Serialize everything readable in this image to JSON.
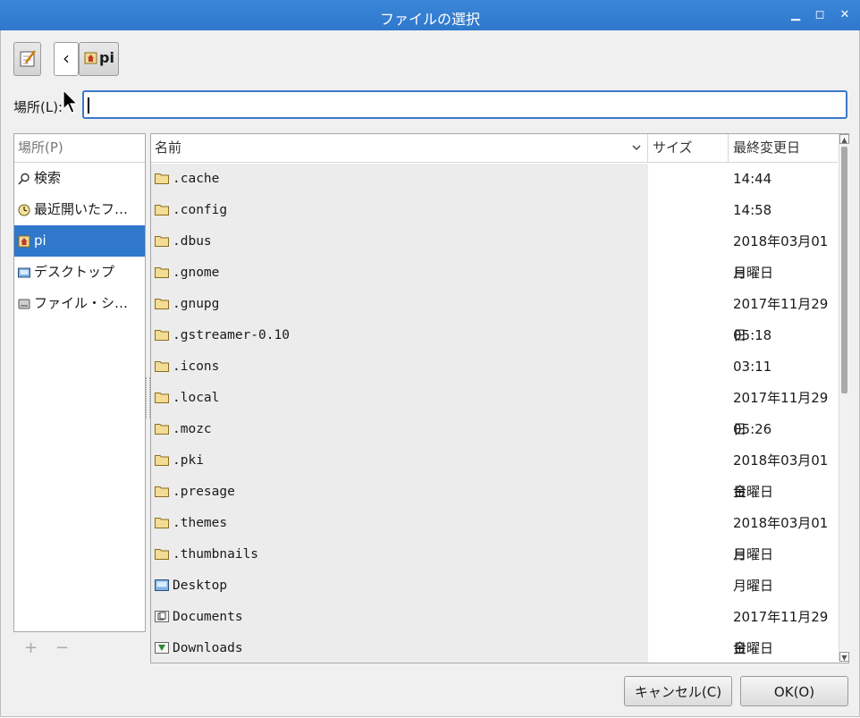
{
  "window": {
    "title": "ファイルの選択",
    "minimize_glyph": "▁",
    "maximize_glyph": "◻",
    "close_glyph": "✕"
  },
  "toolbar": {
    "back_glyph": "‹",
    "path_button_label": "pi",
    "edit_icon": "pencil-icon",
    "home_icon": "home-icon"
  },
  "location": {
    "label": "場所(L):",
    "value": ""
  },
  "places": {
    "header": "場所(P)",
    "items": [
      {
        "label": "検索",
        "icon": "search-icon",
        "selected": false
      },
      {
        "label": "最近開いたフ…",
        "icon": "recent-icon",
        "selected": false
      },
      {
        "label": "pi",
        "icon": "home-icon",
        "selected": true
      },
      {
        "label": "デスクトップ",
        "icon": "desktop-icon",
        "selected": false
      },
      {
        "label": "ファイル・シ…",
        "icon": "drive-icon",
        "selected": false
      }
    ],
    "add_glyph": "+",
    "remove_glyph": "−"
  },
  "columns": {
    "name": "名前",
    "size": "サイズ",
    "modified": "最終変更日"
  },
  "files": [
    {
      "name": ".cache",
      "date": "14:44",
      "icon": "folder-icon"
    },
    {
      "name": ".config",
      "date": "14:58",
      "icon": "folder-icon"
    },
    {
      "name": ".dbus",
      "date": "2018年03月01日",
      "icon": "folder-icon"
    },
    {
      "name": ".gnome",
      "date": "月曜日",
      "icon": "folder-icon"
    },
    {
      "name": ".gnupg",
      "date": "2017年11月29日",
      "icon": "folder-icon"
    },
    {
      "name": ".gstreamer-0.10",
      "date": "05:18",
      "icon": "folder-icon"
    },
    {
      "name": ".icons",
      "date": "03:11",
      "icon": "folder-icon"
    },
    {
      "name": ".local",
      "date": "2017年11月29日",
      "icon": "folder-icon"
    },
    {
      "name": ".mozc",
      "date": "05:26",
      "icon": "folder-icon"
    },
    {
      "name": ".pki",
      "date": "2018年03月01日",
      "icon": "folder-icon"
    },
    {
      "name": ".presage",
      "date": "金曜日",
      "icon": "folder-icon"
    },
    {
      "name": ".themes",
      "date": "2018年03月01日",
      "icon": "folder-icon"
    },
    {
      "name": ".thumbnails",
      "date": "月曜日",
      "icon": "folder-icon"
    },
    {
      "name": "Desktop",
      "date": "月曜日",
      "icon": "desktop-folder-icon"
    },
    {
      "name": "Documents",
      "date": "2017年11月29日",
      "icon": "documents-folder-icon"
    },
    {
      "name": "Downloads",
      "date": "金曜日",
      "icon": "downloads-folder-icon"
    }
  ],
  "buttons": {
    "cancel": "キャンセル(C)",
    "ok": "OK(O)"
  },
  "colors": {
    "accent": "#2f78cc",
    "titlebar": "#3b86d8"
  }
}
